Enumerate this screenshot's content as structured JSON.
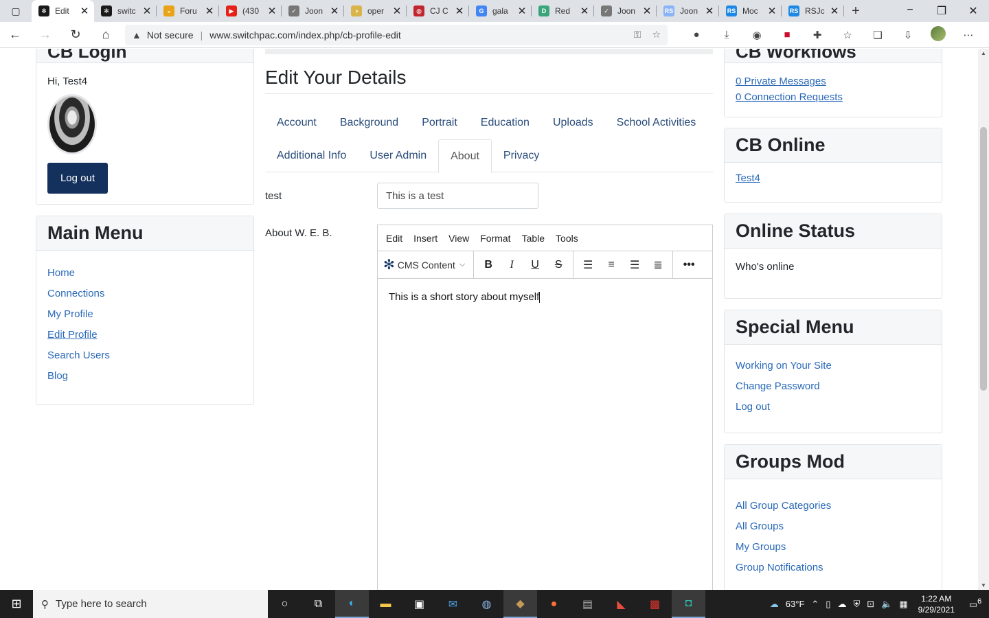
{
  "browser": {
    "tabs": [
      {
        "label": "Edit",
        "icon": "joomla-icon",
        "color": "#1a1a1a",
        "active": true
      },
      {
        "label": "switc",
        "icon": "joomla-icon",
        "color": "#1a1a1a"
      },
      {
        "label": "Foru",
        "icon": "forum-icon",
        "color": "#e8a317"
      },
      {
        "label": "(430",
        "icon": "youtube-icon",
        "color": "#e62117"
      },
      {
        "label": "Joon",
        "icon": "check-icon",
        "color": "#777777"
      },
      {
        "label": "oper",
        "icon": "moon-icon",
        "color": "#d9b44a"
      },
      {
        "label": "CJ C",
        "icon": "stop-icon",
        "color": "#c0262d"
      },
      {
        "label": "gala",
        "icon": "google-icon",
        "color": "#4285f4"
      },
      {
        "label": "Red",
        "icon": "d-icon",
        "color": "#3aa57a"
      },
      {
        "label": "Joon",
        "icon": "check-icon",
        "color": "#777777"
      },
      {
        "label": "Joon",
        "icon": "rs-icon",
        "color": "#8ab4f8"
      },
      {
        "label": "Moc",
        "icon": "rs-icon",
        "color": "#1e88e5"
      },
      {
        "label": "RSJc",
        "icon": "rs-icon",
        "color": "#1e88e5"
      }
    ],
    "not_secure": "Not secure",
    "url": "www.switchpac.com/index.php/cb-profile-edit"
  },
  "login": {
    "title": "CB Login",
    "greeting": "Hi, Test4",
    "logout_label": "Log out"
  },
  "main_menu": {
    "title": "Main Menu",
    "items": [
      "Home",
      "Connections",
      "My Profile",
      "Edit Profile",
      "Search Users",
      "Blog"
    ]
  },
  "edit": {
    "title": "Edit Your Details",
    "tabs_row1": [
      "Account",
      "Background",
      "Portrait",
      "Education",
      "Uploads",
      "School Activities"
    ],
    "tabs_row2": [
      "Additional Info",
      "User Admin",
      "About",
      "Privacy"
    ],
    "active_tab": "About",
    "field_test_label": "test",
    "field_test_value": "This is a test",
    "field_about_label": "About W. E. B.",
    "editor": {
      "menus": [
        "Edit",
        "Insert",
        "View",
        "Format",
        "Table",
        "Tools"
      ],
      "cms_label": "CMS Content",
      "content": "This is a short story about myself"
    }
  },
  "workflows": {
    "title": "CB Workflows",
    "links": [
      "0 Private Messages",
      "0 Connection Requests"
    ]
  },
  "online": {
    "title": "CB Online",
    "user": "Test4"
  },
  "online_status": {
    "title": "Online Status",
    "text": "Who's online"
  },
  "special_menu": {
    "title": "Special Menu",
    "items": [
      "Working on Your Site",
      "Change Password",
      "Log out"
    ]
  },
  "groups_mod": {
    "title": "Groups Mod",
    "items": [
      "All Group Categories",
      "All Groups",
      "My Groups",
      "Group Notifications"
    ]
  },
  "taskbar": {
    "search_placeholder": "Type here to search",
    "weather": "63°F",
    "time": "1:22 AM",
    "date": "9/29/2021",
    "notifications": "6"
  }
}
